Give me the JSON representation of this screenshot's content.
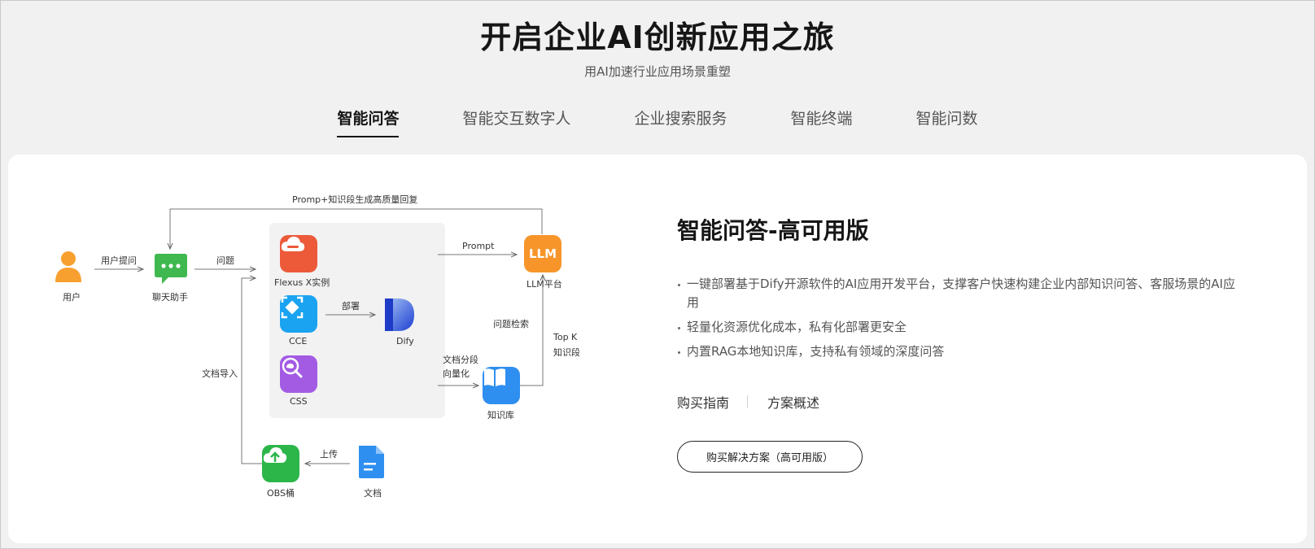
{
  "header": {
    "title": "开启企业AI创新应用之旅",
    "subtitle": "用AI加速行业应用场景重塑"
  },
  "tabs": [
    {
      "label": "智能问答",
      "active": true
    },
    {
      "label": "智能交互数字人",
      "active": false
    },
    {
      "label": "企业搜索服务",
      "active": false
    },
    {
      "label": "智能终端",
      "active": false
    },
    {
      "label": "智能问数",
      "active": false
    }
  ],
  "diagram": {
    "top_label": "Promp+知识段生成高质量回复",
    "user": "用户",
    "user_ask": "用户提问",
    "question": "问题",
    "chat_assistant": "聊天助手",
    "flexus": "Flexus X实例",
    "cce": "CCE",
    "deploy": "部署",
    "dify": "Dify",
    "css": "CSS",
    "prompt": "Prompt",
    "llm_icon": "LLM",
    "llm_platform": "LLM平台",
    "question_search": "问题检索",
    "top_k": "Top K",
    "knowledge_segment": "知识段",
    "doc_segment": "文档分段",
    "vectorize": "向量化",
    "knowledge_base": "知识库",
    "doc_import": "文档导入",
    "upload": "上传",
    "obs": "OBS桶",
    "document": "文档"
  },
  "info": {
    "title": "智能问答-高可用版",
    "bullets": [
      "一键部署基于Dify开源软件的AI应用开发平台，支撑客户快速构建企业内部知识问答、客服场景的AI应用",
      "轻量化资源优化成本，私有化部署更安全",
      "内置RAG本地知识库，支持私有领域的深度问答"
    ],
    "link_guide": "购买指南",
    "link_overview": "方案概述",
    "cta": "购买解决方案（高可用版）"
  },
  "colors": {
    "user_icon": "#f7a030",
    "chat_icon": "#3fb84f",
    "flexus_icon": "#ec5a3a",
    "cce_icon": "#1aa3f0",
    "css_icon": "#a35be3",
    "llm_icon": "#f7952b",
    "kb_icon": "#2e8ff0",
    "obs_icon": "#2cb64a",
    "doc_icon": "#2e8ff0"
  }
}
